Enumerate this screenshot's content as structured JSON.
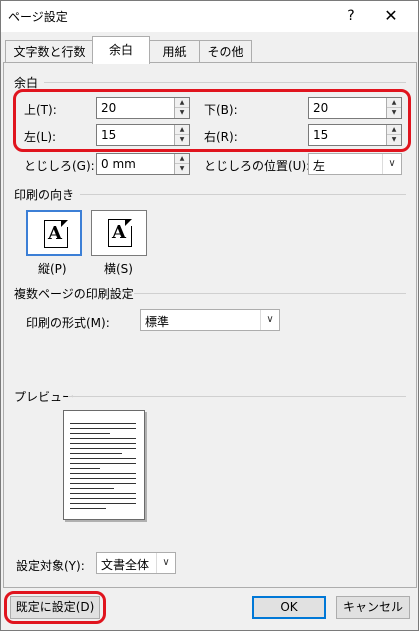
{
  "window": {
    "title": "ページ設定",
    "help": "?",
    "close": "✕"
  },
  "tabs": [
    {
      "label": "文字数と行数",
      "active": false
    },
    {
      "label": "余白",
      "active": true
    },
    {
      "label": "用紙",
      "active": false
    },
    {
      "label": "その他",
      "active": false
    }
  ],
  "margins": {
    "section_label": "余白",
    "top": {
      "label": "上(T):",
      "value": "20"
    },
    "bottom": {
      "label": "下(B):",
      "value": "20"
    },
    "left": {
      "label": "左(L):",
      "value": "15"
    },
    "right": {
      "label": "右(R):",
      "value": "15"
    },
    "gutter": {
      "label": "とじしろ(G):",
      "value": "0 mm"
    },
    "gutter_pos": {
      "label": "とじしろの位置(U):",
      "value": "左"
    }
  },
  "orientation": {
    "section_label": "印刷の向き",
    "portrait_label": "縦(P)",
    "landscape_label": "横(S)",
    "icon_letter": "A"
  },
  "pages": {
    "section_label": "複数ページの印刷設定",
    "format_label": "印刷の形式(M):",
    "format_value": "標準"
  },
  "preview": {
    "section_label": "プレビュー"
  },
  "apply_to": {
    "label": "設定対象(Y):",
    "value": "文書全体"
  },
  "buttons": {
    "default": "既定に設定(D)",
    "ok": "OK",
    "cancel": "キャンセル"
  },
  "colors": {
    "highlight": "#e0141e",
    "selected_border": "#3c7fd6"
  }
}
